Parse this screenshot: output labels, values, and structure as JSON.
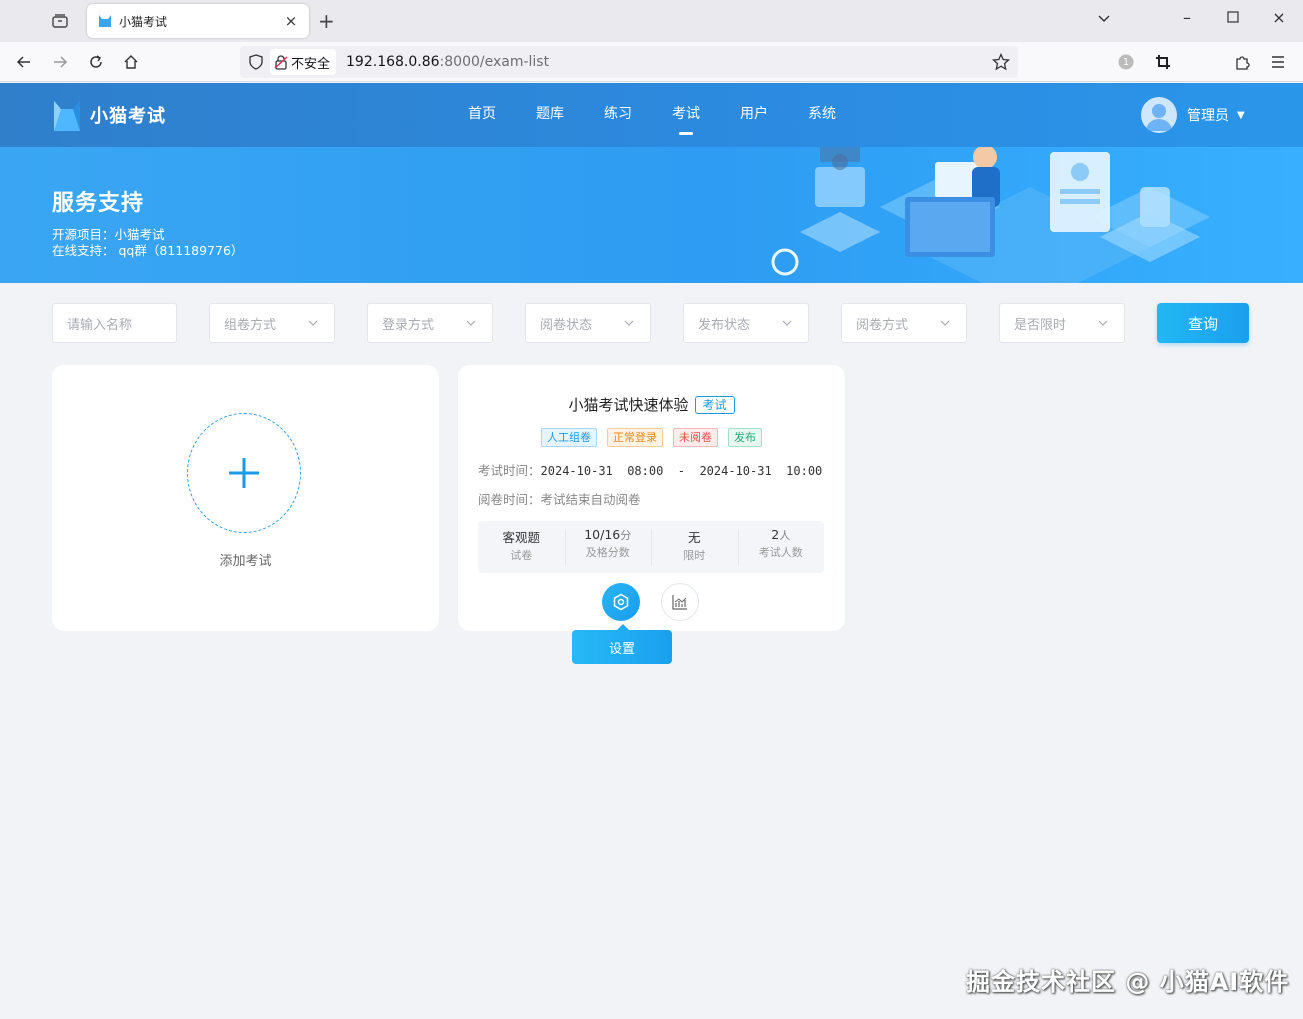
{
  "browser": {
    "tab_title": "小猫考试",
    "url_security": "不安全",
    "url_host": "192.168.0.86",
    "url_path": ":8000/exam-list",
    "notification_count": "1"
  },
  "header": {
    "logo_text": "小猫考试",
    "menu": [
      "首页",
      "题库",
      "练习",
      "考试",
      "用户",
      "系统"
    ],
    "active_menu": "考试",
    "user_name": "管理员"
  },
  "banner": {
    "title": "服务支持",
    "line1": "开源项目：小猫考试",
    "line2": "在线支持： qq群（811189776）"
  },
  "filters": {
    "name_placeholder": "请输入名称",
    "selects": [
      "组卷方式",
      "登录方式",
      "阅卷状态",
      "发布状态",
      "阅卷方式",
      "是否限时"
    ],
    "query_label": "查询"
  },
  "add_card": {
    "label": "添加考试"
  },
  "exam_card": {
    "title": "小猫考试快速体验",
    "badge": "考试",
    "tags": [
      "人工组卷",
      "正常登录",
      "未阅卷",
      "发布"
    ],
    "exam_time_label": "考试时间：",
    "exam_time_value": "2024-10-31  08:00  -  2024-10-31  10:00",
    "mark_time_label": "阅卷时间：",
    "mark_time_value": "考试结束自动阅卷",
    "stats": [
      {
        "value": "客观题",
        "unit": "",
        "label": "试卷"
      },
      {
        "value": "10/16",
        "unit": "分",
        "label": "及格分数"
      },
      {
        "value": "无",
        "unit": "",
        "label": "限时"
      },
      {
        "value": "2",
        "unit": "人",
        "label": "考试人数"
      }
    ],
    "tooltip": "设置"
  },
  "watermark": "掘金技术社区 @ 小猫AI软件",
  "colors": {
    "primary": "#1a9ae6",
    "header": "#2c8be0",
    "page_bg": "#f1f3f6"
  }
}
